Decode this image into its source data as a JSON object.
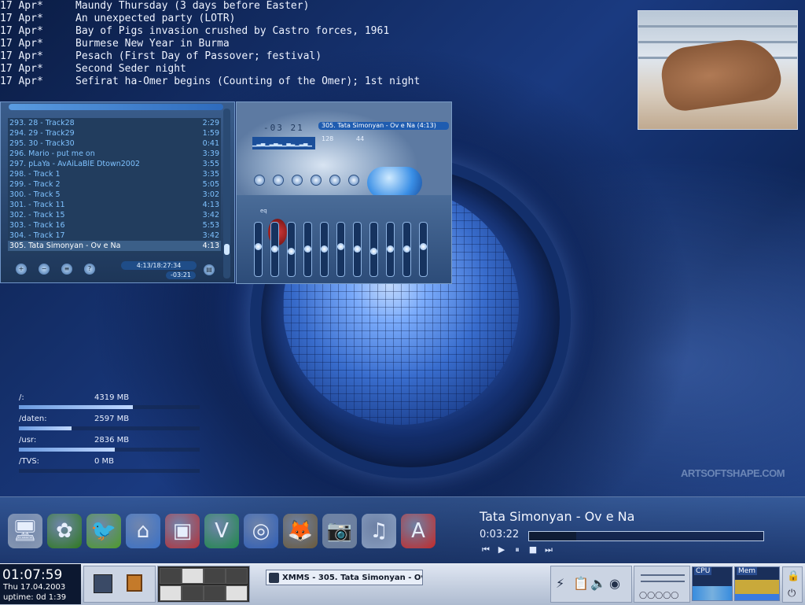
{
  "calendar": [
    {
      "date": "17 Apr*",
      "event": "Maundy Thursday (3 days before Easter)"
    },
    {
      "date": "17 Apr*",
      "event": "An unexpected party (LOTR)"
    },
    {
      "date": "17 Apr*",
      "event": "Bay of Pigs invasion crushed by Castro forces, 1961"
    },
    {
      "date": "17 Apr*",
      "event": "Burmese New Year in Burma"
    },
    {
      "date": "17 Apr*",
      "event": "Pesach (First Day of Passover; festival)"
    },
    {
      "date": "17 Apr*",
      "event": "Second Seder night"
    },
    {
      "date": "17 Apr*",
      "event": "Sefirat ha-Omer begins (Counting of the Omer); 1st night"
    }
  ],
  "playlist": {
    "tracks": [
      {
        "title": "293. 28 - Track28",
        "time": "2:29"
      },
      {
        "title": "294. 29 - Track29",
        "time": "1:59"
      },
      {
        "title": "295. 30 - Track30",
        "time": "0:41"
      },
      {
        "title": "296. Mario - put me on",
        "time": "3:39"
      },
      {
        "title": "297. pLaYa - AvAiLaBlE Dtown2002",
        "time": "3:55"
      },
      {
        "title": "298. - Track 1",
        "time": "3:35"
      },
      {
        "title": "299. - Track 2",
        "time": "5:05"
      },
      {
        "title": "300. - Track 5",
        "time": "3:02"
      },
      {
        "title": "301. - Track 11",
        "time": "4:13"
      },
      {
        "title": "302. - Track 15",
        "time": "3:42"
      },
      {
        "title": "303. - Track 16",
        "time": "5:53"
      },
      {
        "title": "304. - Track 17",
        "time": "3:42"
      },
      {
        "title": "305. Tata Simonyan - Ov e Na",
        "time": "4:13",
        "selected": true
      }
    ],
    "total_time": "4:13/18:27:34",
    "remaining": "-03:21"
  },
  "player": {
    "timer": "-03 21",
    "now_playing": "305. Tata Simonyan - Ov e Na (4:13)",
    "kbps": "128",
    "khz": "44",
    "eq_label": "eq",
    "eq_bands": [
      0.55,
      0.5,
      0.45,
      0.5,
      0.5,
      0.55,
      0.5,
      0.45,
      0.5,
      0.5,
      0.55
    ]
  },
  "disks": [
    {
      "mount": "/:",
      "size": "4319 MB",
      "usage": 0.63
    },
    {
      "mount": "/daten:",
      "size": "2597 MB",
      "usage": 0.29
    },
    {
      "mount": "/usr:",
      "size": "2836 MB",
      "usage": 0.53
    },
    {
      "mount": "/TVS:",
      "size": "0 MB",
      "usage": 0.0
    }
  ],
  "brand": "ARTSOFTSHAPE.COM",
  "dock": {
    "icons": [
      {
        "name": "computer-icon",
        "glyph": "🖥",
        "bg": "#8a9bb5"
      },
      {
        "name": "icq-flower-icon",
        "glyph": "✿",
        "bg": "#2f7a1e"
      },
      {
        "name": "parrot-icon",
        "glyph": "🐦",
        "bg": "#4f9b2a"
      },
      {
        "name": "home-icon",
        "glyph": "⌂",
        "bg": "#3a72c9"
      },
      {
        "name": "terminal-icon",
        "glyph": "▣",
        "bg": "#b5323a"
      },
      {
        "name": "vim-icon",
        "glyph": "V",
        "bg": "#1f8a4a"
      },
      {
        "name": "browser-globe-icon",
        "glyph": "◎",
        "bg": "#2f5fb8"
      },
      {
        "name": "gimp-icon",
        "glyph": "🦊",
        "bg": "#6b5a3a"
      },
      {
        "name": "camera-photo-icon",
        "glyph": "📷",
        "bg": "#6b7e9a"
      },
      {
        "name": "music-note-icon",
        "glyph": "♫",
        "bg": "#8aa0c2"
      },
      {
        "name": "acrobat-icon",
        "glyph": "A",
        "bg": "#c42a2a"
      }
    ],
    "now_playing_artist": "Tata Simonyan - Ov e Na",
    "now_playing_time": "0:03:22",
    "progress": 0.2,
    "controls": [
      "⏮",
      "▶",
      "⏸",
      "■",
      "⏭"
    ]
  },
  "taskbar": {
    "time": "01:07:59",
    "date": "Thu 17.04.2003",
    "uptime": "uptime: 0d 1:39",
    "task_label": "XMMS - 305. Tata Simonyan - Ov",
    "cpu_label": "CPU",
    "mem_label": "Mem"
  }
}
